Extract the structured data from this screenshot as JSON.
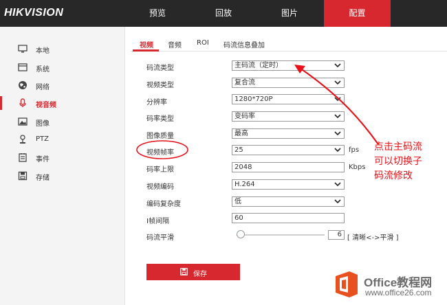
{
  "brand": {
    "logo": "HIKVISION"
  },
  "nav": [
    {
      "label": "预览",
      "active": false
    },
    {
      "label": "回放",
      "active": false
    },
    {
      "label": "图片",
      "active": false
    },
    {
      "label": "配置",
      "active": true
    }
  ],
  "sidebar": {
    "items": [
      {
        "label": "本地",
        "icon": "monitor-icon"
      },
      {
        "label": "系统",
        "icon": "window-icon"
      },
      {
        "label": "网络",
        "icon": "globe-icon"
      },
      {
        "label": "视音频",
        "icon": "microphone-icon",
        "active": true
      },
      {
        "label": "图像",
        "icon": "image-icon"
      },
      {
        "label": "PTZ",
        "icon": "ptz-icon"
      },
      {
        "label": "事件",
        "icon": "calendar-icon"
      },
      {
        "label": "存储",
        "icon": "save-icon"
      }
    ]
  },
  "subtabs": [
    {
      "label": "视频",
      "active": true
    },
    {
      "label": "音频"
    },
    {
      "label": "ROI"
    },
    {
      "label": "码流信息叠加"
    }
  ],
  "form": {
    "stream_type": {
      "label": "码流类型",
      "value": "主码流（定时）"
    },
    "video_type": {
      "label": "视频类型",
      "value": "复合流"
    },
    "resolution": {
      "label": "分辨率",
      "value": "1280*720P"
    },
    "bitrate_type": {
      "label": "码率类型",
      "value": "变码率"
    },
    "image_quality": {
      "label": "图像质量",
      "value": "最高"
    },
    "frame_rate": {
      "label": "视频帧率",
      "value": "25",
      "unit": "fps"
    },
    "bitrate_limit": {
      "label": "码率上限",
      "value": "2048",
      "unit": "Kbps"
    },
    "video_encoding": {
      "label": "视频编码",
      "value": "H.264"
    },
    "encoding_complexity": {
      "label": "编码复杂度",
      "value": "低"
    },
    "i_frame_interval": {
      "label": "I帧间隔",
      "value": "60"
    },
    "smoothing": {
      "label": "码流平滑",
      "value": "6",
      "hint": "[ 清晰<->平滑 ]",
      "level": 0.05
    }
  },
  "save": {
    "label": "保存"
  },
  "annotation": {
    "line1": "点击主码流",
    "line2": "可以切换子",
    "line3": "码流修改"
  },
  "watermark": {
    "line1": "Office教程网",
    "line2": "www.office26.com"
  },
  "colors": {
    "accent": "#d7282f",
    "annotation": "#e8131a"
  }
}
